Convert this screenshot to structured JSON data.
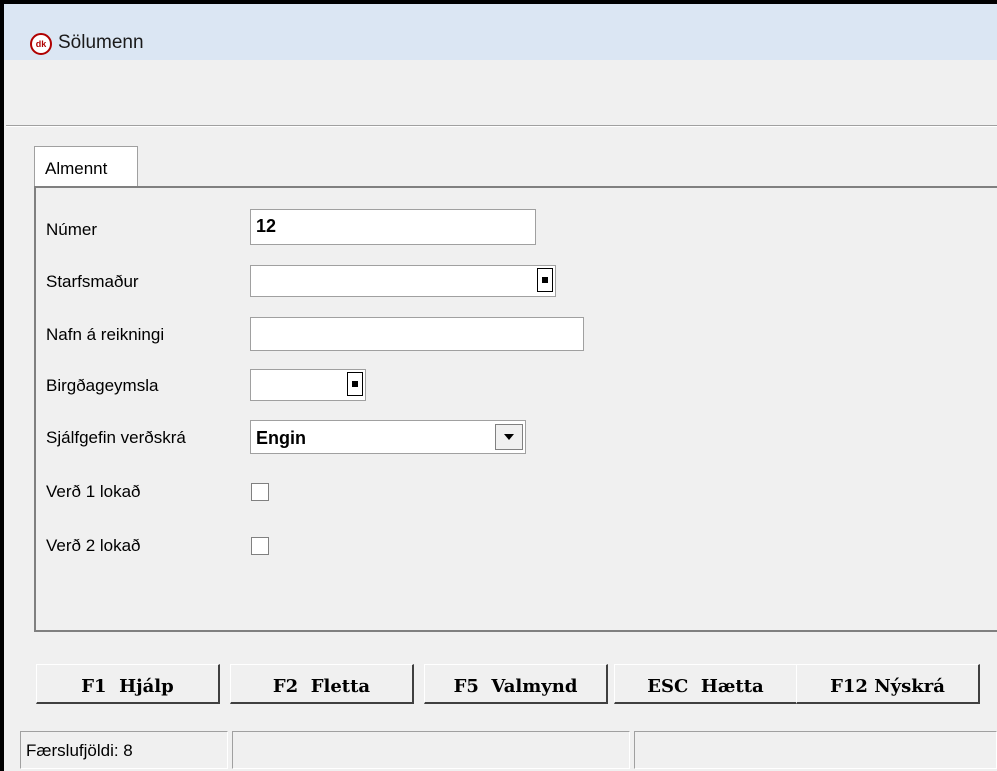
{
  "window": {
    "title": "Sölumenn",
    "app_icon": "dk-logo-icon"
  },
  "tabs": [
    {
      "label": "Almennt",
      "active": true
    }
  ],
  "form": {
    "fields": [
      {
        "label": "Númer",
        "value": "12"
      },
      {
        "label": "Starfsmaður",
        "value": ""
      },
      {
        "label": "Nafn á reikningi",
        "value": ""
      },
      {
        "label": "Birgðageymsla",
        "value": ""
      },
      {
        "label": "Sjálfgefin verðskrá",
        "value": "Engin"
      },
      {
        "label": "Verð 1 lokað",
        "checked": false
      },
      {
        "label": "Verð 2 lokað",
        "checked": false
      }
    ]
  },
  "buttons": [
    {
      "label": "F1  Hjálp"
    },
    {
      "label": "F2  Fletta"
    },
    {
      "label": "F5  Valmynd"
    },
    {
      "label": "ESC  Hætta"
    },
    {
      "label": "F12 Nýskrá"
    }
  ],
  "status": {
    "count": "Færslufjöldi: 8"
  }
}
